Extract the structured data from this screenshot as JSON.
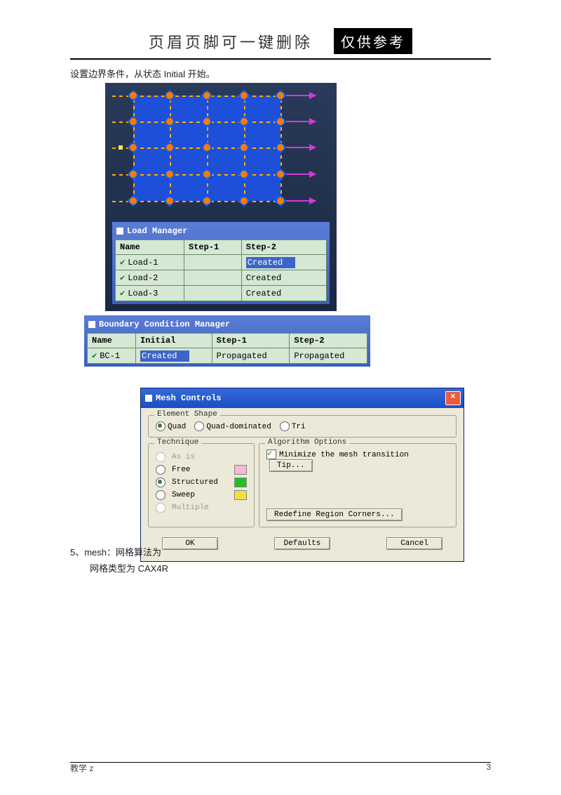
{
  "header": {
    "text": "页眉页脚可一键删除",
    "badge": "仅供参考"
  },
  "body": {
    "line1": "设置边界条件，从状态 Initial 开始。",
    "line2": "5、mesh：网格算法为",
    "line3": "网格类型为 CAX4R"
  },
  "load_manager": {
    "title": "Load Manager",
    "headers": [
      "Name",
      "Step-1",
      "Step-2"
    ],
    "rows": [
      {
        "name": "Load-1",
        "step1": "",
        "step2": "Created",
        "step2_selected": true
      },
      {
        "name": "Load-2",
        "step1": "",
        "step2": "Created"
      },
      {
        "name": "Load-3",
        "step1": "",
        "step2": "Created"
      }
    ]
  },
  "bc_manager": {
    "title": "Boundary Condition Manager",
    "headers": [
      "Name",
      "Initial",
      "Step-1",
      "Step-2"
    ],
    "rows": [
      {
        "name": "BC-1",
        "initial": "Created",
        "initial_selected": true,
        "step1": "Propagated",
        "step2": "Propagated"
      }
    ]
  },
  "mesh_controls": {
    "title": "Mesh Controls",
    "element_shape": {
      "legend": "Element Shape",
      "options": [
        "Quad",
        "Quad-dominated",
        "Tri"
      ],
      "selected": "Quad"
    },
    "technique": {
      "legend": "Technique",
      "options": [
        {
          "label": "As is",
          "disabled": true
        },
        {
          "label": "Free",
          "color": "#f4b8d4"
        },
        {
          "label": "Structured",
          "color": "#20c020",
          "selected": true
        },
        {
          "label": "Sweep",
          "color": "#f0e040"
        },
        {
          "label": "Multiple",
          "disabled": true
        }
      ]
    },
    "algorithm": {
      "legend": "Algorithm Options",
      "minimize": "Minimize the mesh transition",
      "tip": "Tip...",
      "redefine": "Redefine Region Corners..."
    },
    "buttons": {
      "ok": "OK",
      "defaults": "Defaults",
      "cancel": "Cancel"
    }
  },
  "footer": {
    "left": "教学 z",
    "right": "3"
  }
}
